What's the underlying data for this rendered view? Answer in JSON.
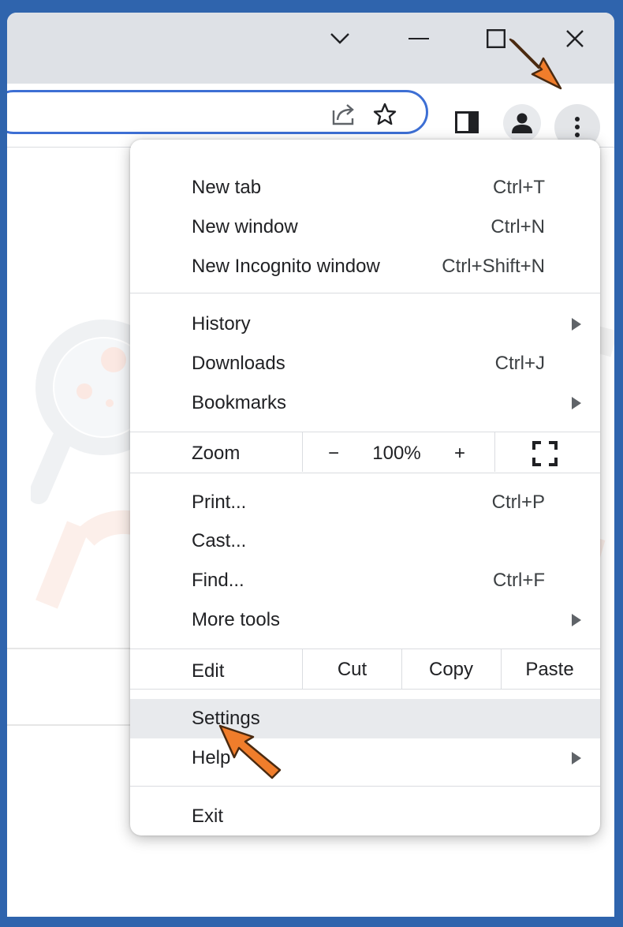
{
  "window": {
    "controls": [
      "chevron-down-icon",
      "minimize-icon",
      "maximize-icon",
      "close-icon"
    ]
  },
  "toolbar": {
    "icons": [
      "share-icon",
      "star-icon",
      "side-panel-icon",
      "profile-icon",
      "more-menu-icon"
    ]
  },
  "menu": {
    "new_tab": {
      "label": "New tab",
      "shortcut": "Ctrl+T"
    },
    "new_window": {
      "label": "New window",
      "shortcut": "Ctrl+N"
    },
    "new_incognito": {
      "label": "New Incognito window",
      "shortcut": "Ctrl+Shift+N"
    },
    "history": {
      "label": "History"
    },
    "downloads": {
      "label": "Downloads",
      "shortcut": "Ctrl+J"
    },
    "bookmarks": {
      "label": "Bookmarks"
    },
    "zoom": {
      "label": "Zoom",
      "minus": "−",
      "value": "100%",
      "plus": "+"
    },
    "print": {
      "label": "Print...",
      "shortcut": "Ctrl+P"
    },
    "cast": {
      "label": "Cast..."
    },
    "find": {
      "label": "Find...",
      "shortcut": "Ctrl+F"
    },
    "more_tools": {
      "label": "More tools"
    },
    "edit": {
      "label": "Edit",
      "cut": "Cut",
      "copy": "Copy",
      "paste": "Paste"
    },
    "settings": {
      "label": "Settings"
    },
    "help": {
      "label": "Help"
    },
    "exit": {
      "label": "Exit"
    }
  },
  "colors": {
    "border_blue": "#2f64ad",
    "omnibox_focus": "#3d6fd4",
    "pointer_orange": "#f07d2b",
    "hover_gray": "#e8eaed"
  }
}
